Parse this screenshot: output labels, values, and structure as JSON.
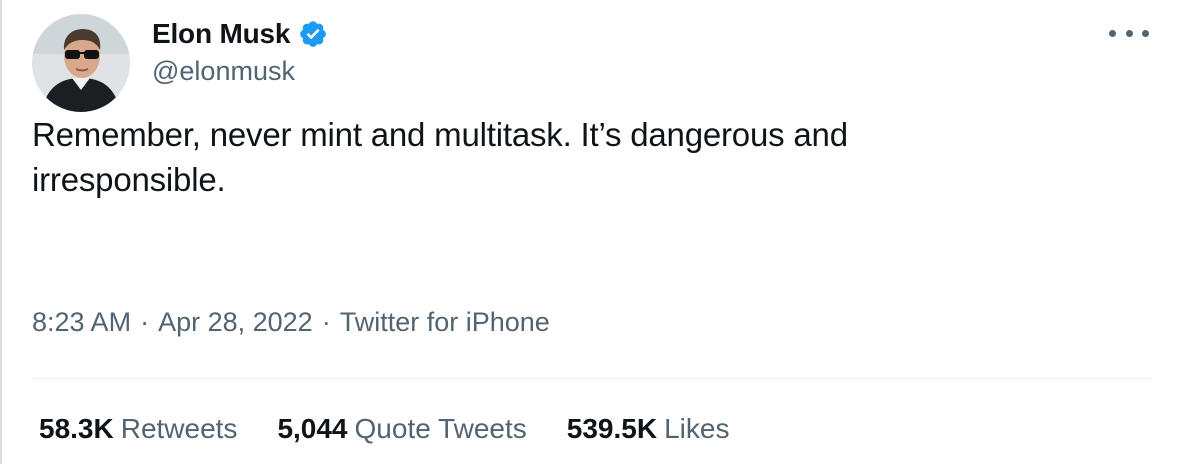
{
  "author": {
    "display_name": "Elon Musk",
    "handle": "@elonmusk",
    "verified": true
  },
  "tweet": {
    "text": "Remember, never mint and multitask. It’s dangerous and irresponsible.",
    "time": "8:23 AM",
    "date": "Apr 28, 2022",
    "source": "Twitter for iPhone",
    "separator": "·"
  },
  "stats": {
    "retweets_count": "58.3K",
    "retweets_label": "Retweets",
    "quote_tweets_count": "5,044",
    "quote_tweets_label": "Quote Tweets",
    "likes_count": "539.5K",
    "likes_label": "Likes"
  },
  "colors": {
    "text_primary": "#0f1419",
    "text_secondary": "#536471",
    "verified_blue": "#1d9bf0",
    "divider": "#eff3f4"
  },
  "icons": {
    "verified": "verified-badge-icon",
    "more": "more-options-icon"
  }
}
